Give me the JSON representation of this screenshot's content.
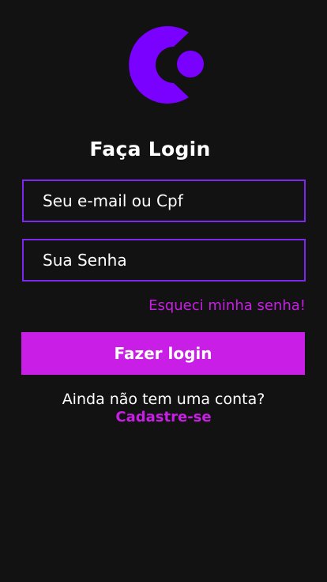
{
  "logo": {
    "icon": "brand-c-logo-icon",
    "color": "#7a00ff"
  },
  "title": "Faça Login",
  "fields": {
    "email": {
      "placeholder": "Seu e-mail ou Cpf",
      "value": ""
    },
    "password": {
      "placeholder": "Sua Senha",
      "value": ""
    }
  },
  "forgot_password": "Esqueci minha senha!",
  "login_button": "Fazer login",
  "signup": {
    "prompt": "Ainda não tem uma conta?",
    "link": "Cadastre-se"
  },
  "colors": {
    "background": "#121212",
    "accent": "#c81ee6",
    "field_border": "#7c28f0",
    "logo": "#7a00ff"
  }
}
